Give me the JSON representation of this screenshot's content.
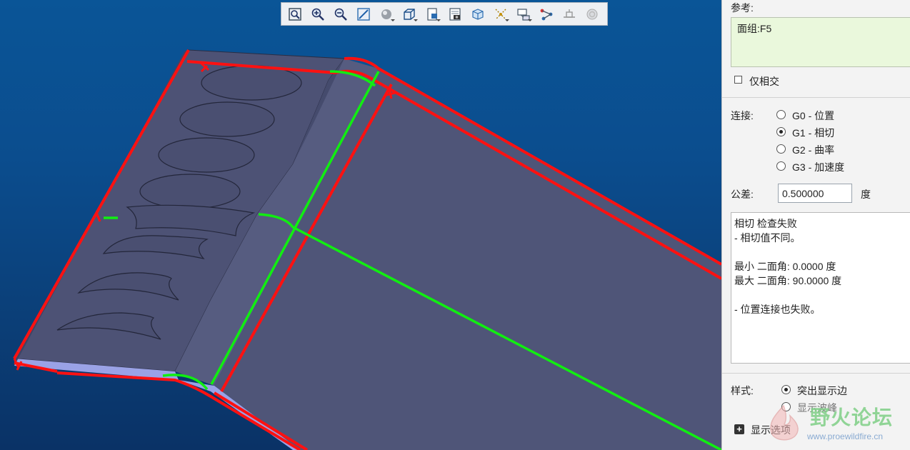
{
  "toolbar": {
    "icons": [
      "zoom-fit-icon",
      "zoom-in-icon",
      "zoom-out-icon",
      "pan-icon",
      "display-style-icon",
      "view-orientation-icon",
      "saved-views-icon",
      "camera-icon",
      "view-manager-icon",
      "datum-display-icon",
      "annotation-display-icon",
      "spin-center-icon",
      "feature-display-icon",
      "appearance-icon"
    ]
  },
  "panel": {
    "reference_label": "参考:",
    "reference_value": "面组:F5",
    "intersect_only_label": "仅相交",
    "intersect_only_checked": false,
    "connection_label": "连接:",
    "connection_options": [
      {
        "label": "G0 - 位置",
        "selected": false
      },
      {
        "label": "G1 - 相切",
        "selected": true
      },
      {
        "label": "G2 - 曲率",
        "selected": false
      },
      {
        "label": "G3 - 加速度",
        "selected": false
      }
    ],
    "tolerance_label": "公差:",
    "tolerance_value": "0.500000",
    "tolerance_unit": "度",
    "result_text": "相切 检查失败\n- 相切值不同。\n\n最小 二面角: 0.0000 度\n最大 二面角: 90.0000 度\n\n- 位置连接也失败。",
    "style_label": "样式:",
    "style_options": [
      {
        "label": "突出显示边",
        "selected": true
      },
      {
        "label": "显示波峰",
        "selected": false
      }
    ],
    "display_options_label": "显示选项"
  },
  "watermark": {
    "title": "野火论坛",
    "url": "www.proewildfire.cn"
  },
  "colors": {
    "viewport_top": "#0a5597",
    "viewport_bottom": "#0a3266",
    "surface": "#4e5476",
    "edge_fail": "#ff1111",
    "edge_ok": "#11ee11",
    "panel_bg": "#f3f3f3",
    "reference_bg": "#eaf8dc"
  }
}
